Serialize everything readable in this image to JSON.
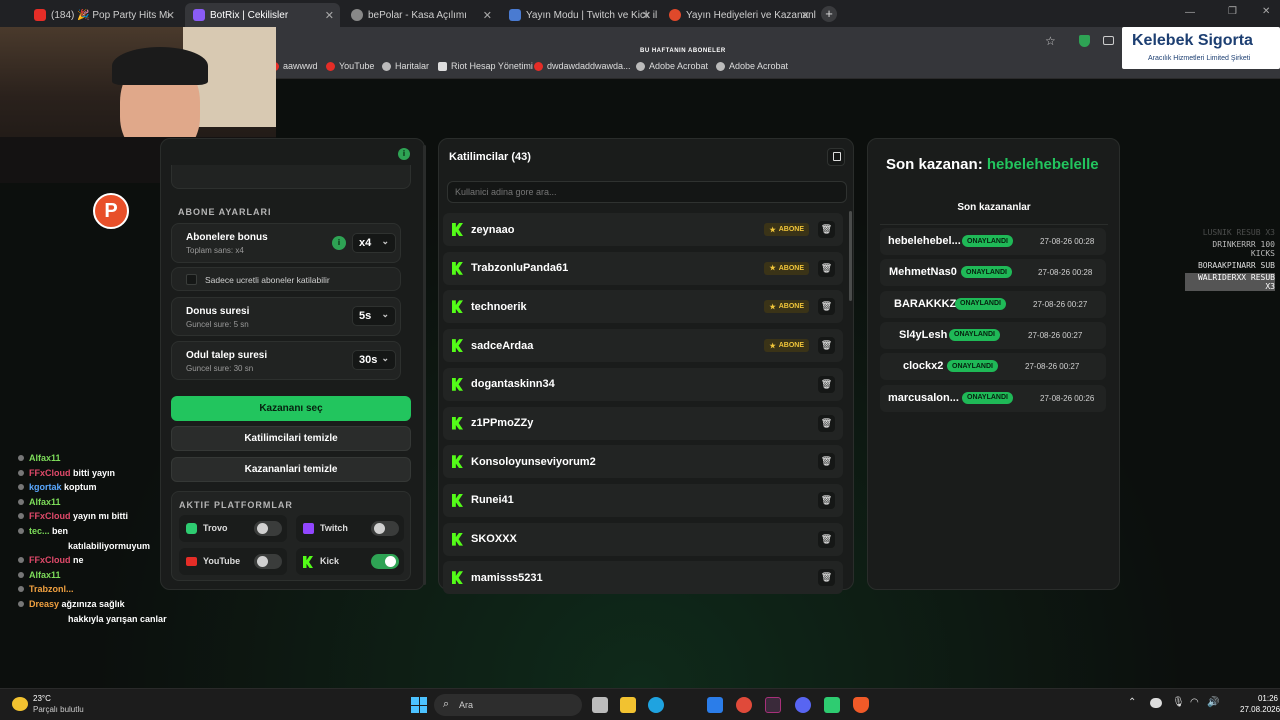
{
  "tabs": [
    {
      "label": "(184) 🎉 Pop Party Hits Mi",
      "color": "#e52d27"
    },
    {
      "label": "BotRix | Cekilisler",
      "color": "#8a5cf6"
    },
    {
      "label": "bePolar - Kasa Açılımı",
      "color": "#888888"
    },
    {
      "label": "Yayın Modu | Twitch ve Kick ile",
      "color": "#4a7bd1"
    },
    {
      "label": "Yayın Hediyeleri ve Kazananla",
      "color": "#e0492b"
    }
  ],
  "bookmarks": [
    "aawwwd",
    "YouTube",
    "Haritalar",
    "Riot Hesap Yönetimi",
    "dwdawdaddwawda...",
    "Adobe Acrobat",
    "Adobe Acrobat"
  ],
  "overlay": {
    "week_subs_title": "BU HAFTANIN ABONELER",
    "sponsor_name": "Kelebek Sigorta",
    "sponsor_sub": "Aracılık Hizmetleri Limited Şirketi",
    "stream_feed": [
      "LUSNIK RESUB X3",
      "DRINKERRR 100 KICKS",
      "BORAAKPINARR SUB",
      "WALRIDERXX RESUB X3"
    ]
  },
  "settings": {
    "sub_section_label": "ABONE AYARLARI",
    "bonus_title": "Abonelere bonus",
    "bonus_sub": "Toplam sans: x4",
    "bonus_value": "x4",
    "paid_only_label": "Sadece ucretli aboneler katilabilir",
    "bonus_time_title": "Donus suresi",
    "bonus_time_sub": "Guncel sure: 5 sn",
    "bonus_time_value": "5s",
    "claim_title": "Odul talep suresi",
    "claim_sub": "Guncel sure: 30 sn",
    "claim_value": "30s",
    "pick_winner": "Kazananı seç",
    "clear_participants": "Katilimcilari temizle",
    "clear_winners": "Kazananlari temizle",
    "platforms_label": "AKTIF PLATFORMLAR",
    "platforms": [
      {
        "name": "Trovo",
        "on": false
      },
      {
        "name": "Twitch",
        "on": false
      },
      {
        "name": "YouTube",
        "on": false
      },
      {
        "name": "Kick",
        "on": true
      }
    ]
  },
  "participants": {
    "title": "Katilimcilar (43)",
    "search_placeholder": "Kullanici adina gore ara...",
    "badge": "ABONE",
    "rows": [
      {
        "name": "zeynaao",
        "abone": true
      },
      {
        "name": "TrabzonluPanda61",
        "abone": true
      },
      {
        "name": "technoerik",
        "abone": true
      },
      {
        "name": "sadceArdaa",
        "abone": true
      },
      {
        "name": "dogantaskinn34",
        "abone": false
      },
      {
        "name": "z1PPmoZZy",
        "abone": false
      },
      {
        "name": "Konsoloyunseviyorum2",
        "abone": false
      },
      {
        "name": "Runei41",
        "abone": false
      },
      {
        "name": "SKOXXX",
        "abone": false
      },
      {
        "name": "mamisss5231",
        "abone": false
      }
    ]
  },
  "winners": {
    "last_label": "Son kazanan:",
    "last_name": "hebelehebelelle",
    "list_title": "Son kazananlar",
    "status": "ONAYLANDI",
    "rows": [
      {
        "name": "hebelehebel...",
        "date": "27-08-26 00:28"
      },
      {
        "name": "MehmetNas0",
        "date": "27-08-26 00:28"
      },
      {
        "name": "BARAKKKZ",
        "date": "27-08-26 00:27"
      },
      {
        "name": "Sl4yLesh",
        "date": "27-08-26 00:27"
      },
      {
        "name": "clockx2",
        "date": "27-08-26 00:27"
      },
      {
        "name": "marcusalon...",
        "date": "27-08-26 00:26"
      }
    ]
  },
  "chat": [
    {
      "user": "Alfax11",
      "msg": "",
      "color": "#7ddc5a"
    },
    {
      "user": "FFxCloud",
      "msg": "bitti yayın",
      "color": "#e04a6a"
    },
    {
      "user": "kgortak",
      "msg": "koptum",
      "color": "#5aa8ff"
    },
    {
      "user": "Alfax11",
      "msg": "",
      "color": "#7ddc5a"
    },
    {
      "user": "FFxCloud",
      "msg": "yayın mı bitti",
      "color": "#e04a6a"
    },
    {
      "user": "tec...",
      "msg": "ben",
      "color": "#7ddc5a"
    },
    {
      "user": "",
      "msg": "katılabiliyormuyum",
      "color": "#ffffff"
    },
    {
      "user": "FFxCloud",
      "msg": "ne",
      "color": "#e04a6a"
    },
    {
      "user": "Alfax11",
      "msg": "",
      "color": "#7ddc5a"
    },
    {
      "user": "Trabzonl...",
      "msg": "",
      "color": "#f0a040"
    },
    {
      "user": "Dreasy",
      "msg": "ağzınıza sağlık",
      "color": "#f0a040"
    },
    {
      "user": "",
      "msg": "hakkıyla yarışan canlar",
      "color": "#ffffff"
    }
  ],
  "taskbar": {
    "weather_temp": "23°C",
    "weather_desc": "Parçalı bulutlu",
    "search": "Ara",
    "time": "01:26",
    "date": "27.08.2026"
  }
}
